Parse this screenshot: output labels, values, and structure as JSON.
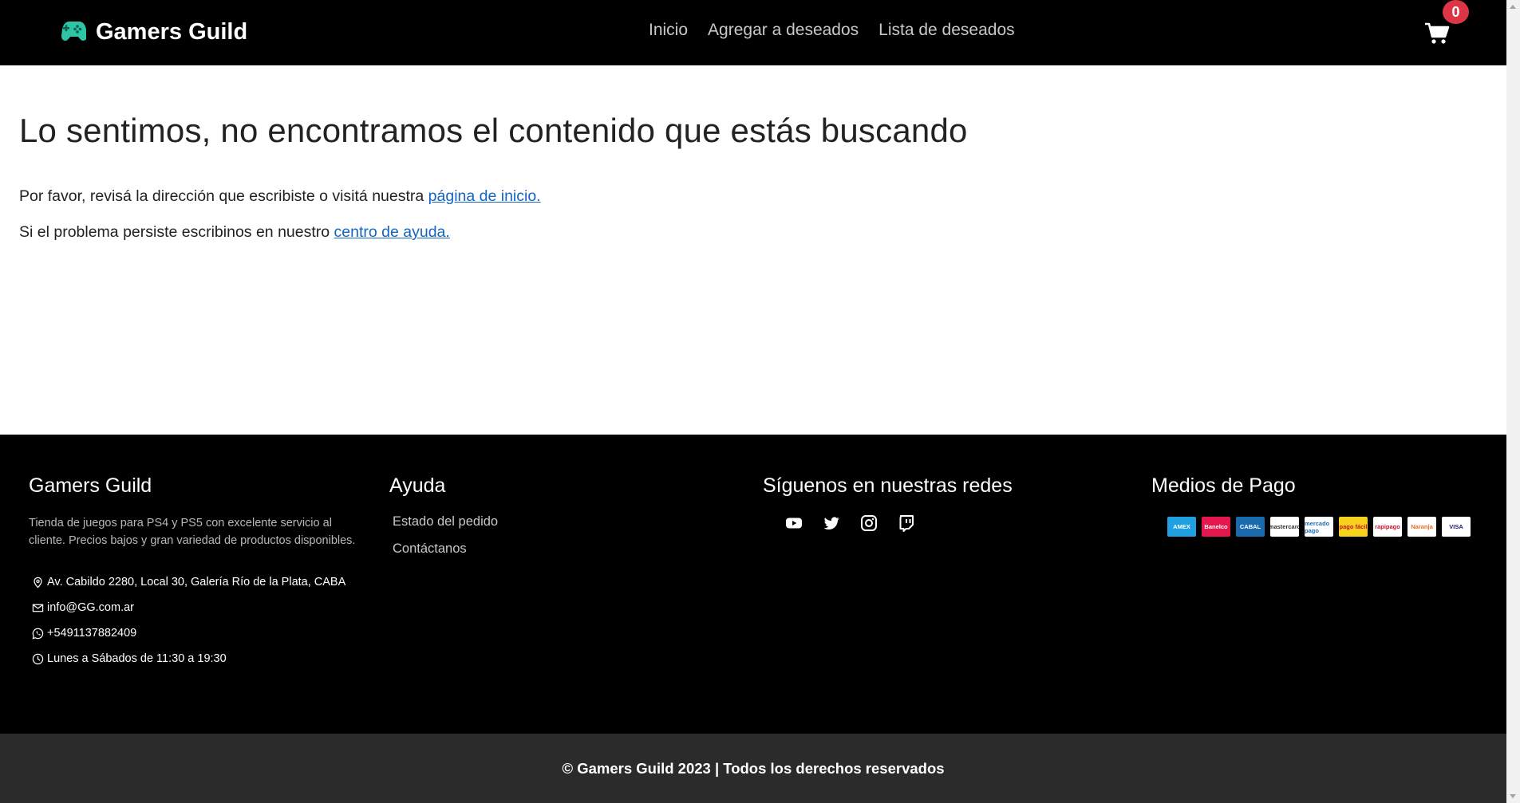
{
  "navbar": {
    "brand": "Gamers Guild",
    "links": [
      "Inicio",
      "Agregar a deseados",
      "Lista de deseados"
    ],
    "cart_count": "0"
  },
  "main": {
    "title": "Lo sentimos, no encontramos el contenido que estás buscando",
    "line1_text": "Por favor, revisá la dirección que escribiste o visitá nuestra ",
    "line1_link": "página de inicio.",
    "line2_text": "Si el problema persiste escribinos en nuestro ",
    "line2_link": "centro de ayuda."
  },
  "footer": {
    "about": {
      "title": "Gamers Guild",
      "description": "Tienda de juegos para PS4 y PS5 con excelente servicio al cliente. Precios bajos y gran variedad de productos disponibles.",
      "address": "Av. Cabildo 2280, Local 30, Galería Río de la Plata, CABA",
      "email": "info@GG.com.ar",
      "phone": "+5491137882409",
      "hours": "Lunes a Sábados de 11:30 a 19:30"
    },
    "help": {
      "title": "Ayuda",
      "links": [
        "Estado del pedido",
        "Contáctanos"
      ]
    },
    "social": {
      "title": "Síguenos en nuestras redes",
      "icons": [
        "youtube-icon",
        "twitter-icon",
        "instagram-icon",
        "twitch-icon"
      ]
    },
    "payments": {
      "title": "Medios de Pago",
      "cards": [
        {
          "label": "AMEX",
          "bg": "#1fa0e0",
          "fg": "#ffffff"
        },
        {
          "label": "Banelco",
          "bg": "#e5174d",
          "fg": "#ffffff"
        },
        {
          "label": "CABAL",
          "bg": "#1a6ab0",
          "fg": "#ffffff"
        },
        {
          "label": "mastercard",
          "bg": "#ffffff",
          "fg": "#333333"
        },
        {
          "label": "mercado pago",
          "bg": "#ffffff",
          "fg": "#1b6fb7"
        },
        {
          "label": "pago fácil",
          "bg": "#f6d21c",
          "fg": "#c8102e"
        },
        {
          "label": "rapipago",
          "bg": "#ffffff",
          "fg": "#d0102b"
        },
        {
          "label": "Naranja",
          "bg": "#ffffff",
          "fg": "#f26722"
        },
        {
          "label": "VISA",
          "bg": "#ffffff",
          "fg": "#1a1f71"
        }
      ]
    }
  },
  "copyright": "© Gamers Guild 2023 | Todos los derechos reservados",
  "colors": {
    "navbar_bg": "#000000",
    "badge_red": "#dc3545",
    "link_blue": "#1565c0",
    "brand_teal": "#2ec4a6",
    "copyright_bg": "#2b2b2b"
  }
}
